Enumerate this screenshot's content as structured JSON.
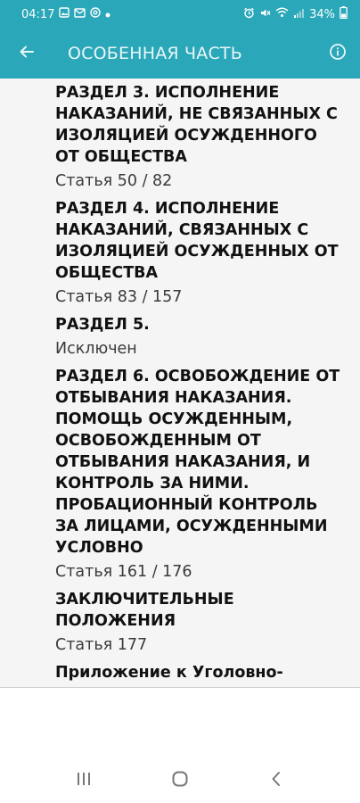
{
  "status_bar": {
    "time": "04:17",
    "battery": "34%"
  },
  "app_bar": {
    "title": "ОСОБЕННАЯ ЧАСТЬ",
    "back_icon": "arrow-left-icon",
    "info_icon": "info-circle-icon"
  },
  "sections": [
    {
      "title": "РАЗДЕЛ 3. ИСПОЛНЕНИЕ НАКАЗАНИЙ, НЕ СВЯЗАННЫХ С ИЗОЛЯЦИЕЙ ОСУЖДЕННОГО ОТ ОБЩЕСТВА",
      "subtitle": "Статья 50 / 82"
    },
    {
      "title": "РАЗДЕЛ 4. ИСПОЛНЕНИЕ НАКАЗАНИЙ, СВЯЗАННЫХ С ИЗОЛЯЦИЕЙ ОСУЖДЕННЫХ ОТ ОБЩЕСТВА",
      "subtitle": "Статья 83 / 157"
    },
    {
      "title": "РАЗДЕЛ 5.",
      "subtitle": "Исключен"
    },
    {
      "title": "РАЗДЕЛ 6. ОСВОБОЖДЕНИЕ ОТ ОТБЫВАНИЯ НАКАЗАНИЯ. ПОМОЩЬ ОСУЖДЕННЫМ, ОСВОБОЖДЕННЫМ ОТ ОТБЫВАНИЯ НАКАЗАНИЯ,  И КОНТРОЛЬ ЗА НИМИ. ПРОБАЦИОННЫЙ КОНТРОЛЬ ЗА ЛИЦАМИ, ОСУЖДЕННЫМИ УСЛОВНО",
      "subtitle": "Статья 161 / 176"
    },
    {
      "title": "ЗАКЛЮЧИТЕЛЬНЫЕ ПОЛОЖЕНИЯ",
      "subtitle": "Статья 177"
    },
    {
      "title": "Приложение  к Уголовно-",
      "subtitle": ""
    }
  ],
  "colors": {
    "accent": "#2aa7b8",
    "content_bg": "#f5f5f5"
  }
}
